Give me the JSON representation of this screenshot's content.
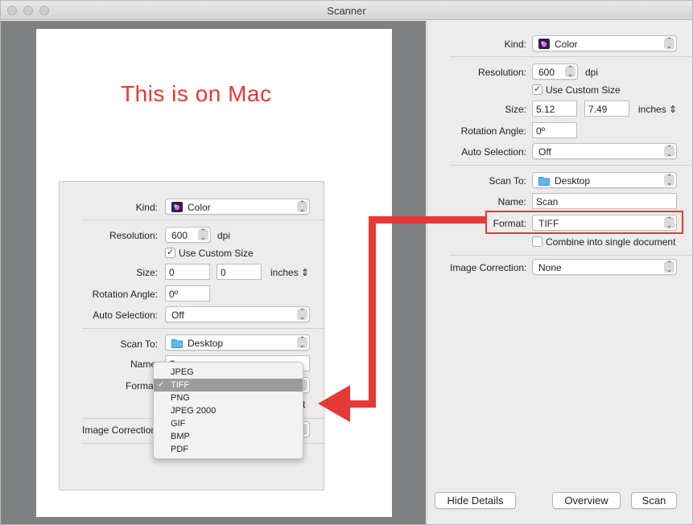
{
  "window": {
    "title": "Scanner"
  },
  "preview": {
    "overlay_text": "This is on Mac"
  },
  "settings": {
    "kind": {
      "label": "Kind:",
      "value": "Color"
    },
    "resolution": {
      "label": "Resolution:",
      "value": "600",
      "unit": "dpi"
    },
    "custom_size": {
      "label": "Use Custom Size",
      "checked": true
    },
    "size": {
      "label": "Size:",
      "width": "5.12",
      "height": "7.49",
      "unit": "inches"
    },
    "rotation": {
      "label": "Rotation Angle:",
      "value": "0º"
    },
    "auto_selection": {
      "label": "Auto Selection:",
      "value": "Off"
    },
    "scan_to": {
      "label": "Scan To:",
      "value": "Desktop"
    },
    "name": {
      "label": "Name:",
      "value": "Scan"
    },
    "format": {
      "label": "Format:",
      "value": "TIFF"
    },
    "combine": {
      "label": "Combine into single document",
      "checked": false
    },
    "image_correction": {
      "label": "Image Correction:",
      "value": "None"
    }
  },
  "embedded": {
    "kind": {
      "label": "Kind:",
      "value": "Color"
    },
    "resolution": {
      "label": "Resolution:",
      "value": "600",
      "unit": "dpi"
    },
    "custom_size": {
      "label": "Use Custom Size",
      "checked": true
    },
    "size": {
      "label": "Size:",
      "width": "0",
      "height": "0",
      "unit": "inches"
    },
    "rotation": {
      "label": "Rotation Angle:",
      "value": "0º"
    },
    "auto_selection": {
      "label": "Auto Selection:",
      "value": "Off"
    },
    "scan_to": {
      "label": "Scan To:",
      "value": "Desktop"
    },
    "name": {
      "label": "Name",
      "value": "S"
    },
    "format": {
      "label": "Format"
    },
    "combine_tail": "t",
    "image_correction": {
      "label": "Image Correction"
    },
    "format_menu": {
      "selected": "TIFF",
      "options": [
        "JPEG",
        "TIFF",
        "PNG",
        "JPEG 2000",
        "GIF",
        "BMP",
        "PDF"
      ]
    }
  },
  "buttons": {
    "hide_details": "Hide Details",
    "overview": "Overview",
    "scan": "Scan"
  },
  "icons": {
    "stepper": "⌃⌄",
    "checkmark": "✓",
    "size_stepper": "⇕"
  },
  "colors": {
    "annotation": "#e53935",
    "folder": "#5fb7f0",
    "selected_menu": "#9c9c9c"
  }
}
